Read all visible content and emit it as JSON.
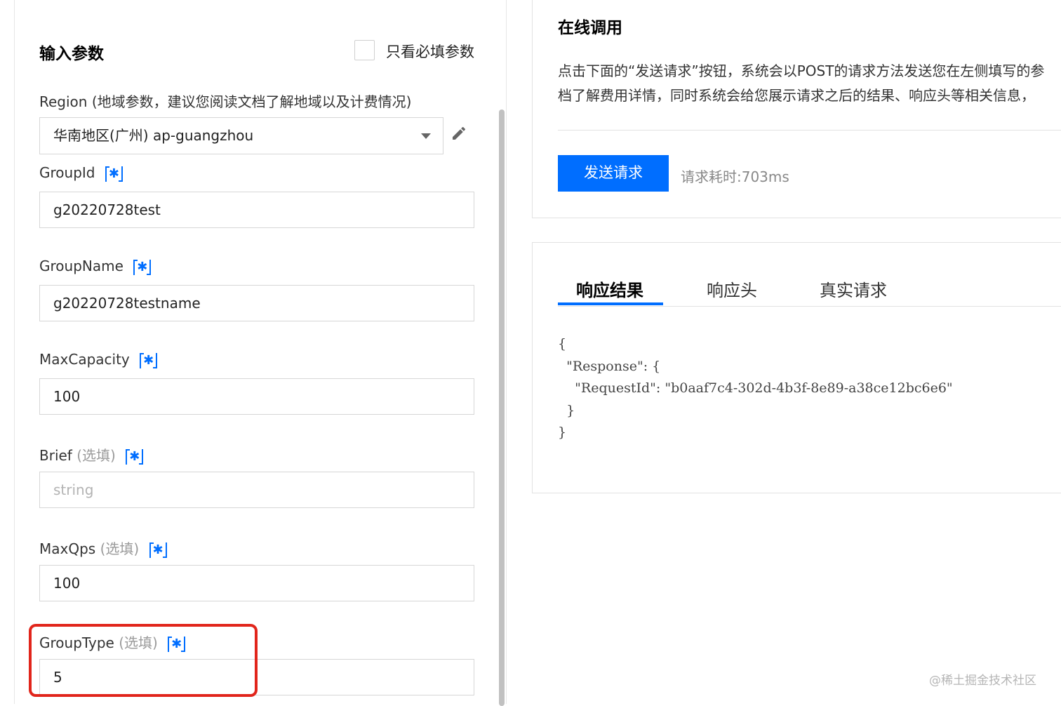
{
  "params": {
    "title": "输入参数",
    "required_only_label": "只看必填参数"
  },
  "region": {
    "label": "Region (地域参数，建议您阅读文档了解地域以及计费情况)",
    "value": "华南地区(广州) ap-guangzhou"
  },
  "fields": [
    {
      "name": "GroupId",
      "optional": "",
      "value": "g20220728test",
      "is_placeholder": false
    },
    {
      "name": "GroupName",
      "optional": "",
      "value": "g20220728testname",
      "is_placeholder": false
    },
    {
      "name": "MaxCapacity",
      "optional": "",
      "value": "100",
      "is_placeholder": false
    },
    {
      "name": "Brief",
      "optional": "(选填)",
      "value": "string",
      "is_placeholder": true
    },
    {
      "name": "MaxQps",
      "optional": "(选填)",
      "value": "100",
      "is_placeholder": false
    },
    {
      "name": "GroupType",
      "optional": "(选填)",
      "value": "5",
      "is_placeholder": false
    }
  ],
  "required_marker": "✱",
  "online": {
    "title": "在线调用",
    "desc_line1": "点击下面的“发送请求”按钮，系统会以POST的请求方法发送您在左侧填写的参",
    "desc_line2": "档了解费用详情，同时系统会给您展示请求之后的结果、响应头等相关信息，",
    "send_button": "发送请求",
    "elapsed": "请求耗时:703ms"
  },
  "result": {
    "tabs": [
      "响应结果",
      "响应头",
      "真实请求"
    ],
    "active_tab": "响应结果",
    "code": "{\n  \"Response\": {\n    \"RequestId\": \"b0aaf7c4-302d-4b3f-8e89-a38ce12bc6e6\"\n  }\n}"
  },
  "watermark": "@稀土掘金技术社区",
  "colors": {
    "accent": "#006eff",
    "highlight": "#e1251b",
    "optional_text": "#9a9a9a"
  }
}
